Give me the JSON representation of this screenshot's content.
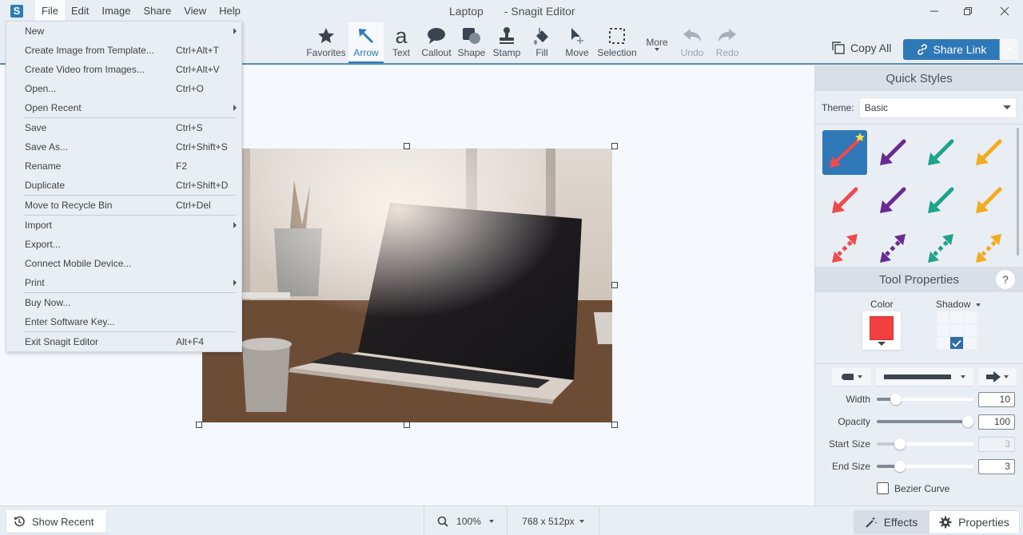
{
  "app": {
    "logo": "S",
    "document_title": "Laptop",
    "app_title": "- Snagit Editor"
  },
  "menubar": [
    {
      "label": "File",
      "active": true
    },
    {
      "label": "Edit"
    },
    {
      "label": "Image"
    },
    {
      "label": "Share"
    },
    {
      "label": "View"
    },
    {
      "label": "Help"
    }
  ],
  "window_controls": {
    "minimize": "minimize-icon",
    "restore": "restore-icon",
    "close": "close-icon"
  },
  "toolbar": {
    "tools": [
      {
        "label": "Favorites",
        "icon": "star-icon"
      },
      {
        "label": "Arrow",
        "icon": "arrow-icon",
        "selected": true
      },
      {
        "label": "Text",
        "icon": "text-icon"
      },
      {
        "label": "Callout",
        "icon": "callout-icon"
      },
      {
        "label": "Shape",
        "icon": "shape-icon"
      },
      {
        "label": "Stamp",
        "icon": "stamp-icon"
      },
      {
        "label": "Fill",
        "icon": "fill-icon"
      },
      {
        "label": "Move",
        "icon": "move-icon"
      },
      {
        "label": "Selection",
        "icon": "selection-icon"
      }
    ],
    "more_label": "More",
    "undo_label": "Undo",
    "redo_label": "Redo",
    "copy_all_label": "Copy All",
    "share_link_label": "Share Link"
  },
  "file_menu": {
    "groups": [
      [
        {
          "label": "New",
          "shortcut": "",
          "submenu": true
        },
        {
          "label": "Create Image from Template...",
          "shortcut": "Ctrl+Alt+T"
        },
        {
          "label": "Create Video from Images...",
          "shortcut": "Ctrl+Alt+V"
        },
        {
          "label": "Open...",
          "shortcut": "Ctrl+O"
        },
        {
          "label": "Open Recent",
          "shortcut": "",
          "submenu": true
        }
      ],
      [
        {
          "label": "Save",
          "shortcut": "Ctrl+S"
        },
        {
          "label": "Save As...",
          "shortcut": "Ctrl+Shift+S"
        },
        {
          "label": "Rename",
          "shortcut": "F2"
        },
        {
          "label": "Duplicate",
          "shortcut": "Ctrl+Shift+D"
        }
      ],
      [
        {
          "label": "Move to Recycle Bin",
          "shortcut": "Ctrl+Del"
        }
      ],
      [
        {
          "label": "Import",
          "shortcut": "",
          "submenu": true
        },
        {
          "label": "Export...",
          "shortcut": ""
        },
        {
          "label": "Connect Mobile Device...",
          "shortcut": ""
        },
        {
          "label": "Print",
          "shortcut": "",
          "submenu": true
        }
      ],
      [
        {
          "label": "Buy Now...",
          "shortcut": ""
        },
        {
          "label": "Enter Software Key...",
          "shortcut": ""
        }
      ],
      [
        {
          "label": "Exit Snagit Editor",
          "shortcut": "Alt+F4"
        }
      ]
    ]
  },
  "quick_styles": {
    "title": "Quick Styles",
    "theme_label": "Theme:",
    "theme_value": "Basic",
    "colors": [
      "#ef4b4b",
      "#6a2a96",
      "#1fa38a",
      "#f2ac1e"
    ],
    "selected_bg": "#2f78b7"
  },
  "tool_properties": {
    "title": "Tool Properties",
    "help": "?",
    "color_label": "Color",
    "color_value": "#f23f3f",
    "shadow_label": "Shadow",
    "shadow_selected": "bottom-center",
    "sliders": [
      {
        "label": "Width",
        "value": "10",
        "fraction": 0.2,
        "disabled": false
      },
      {
        "label": "Opacity",
        "value": "100",
        "fraction": 0.94,
        "disabled": false
      },
      {
        "label": "Start Size",
        "value": "3",
        "fraction": 0.24,
        "disabled": true
      },
      {
        "label": "End Size",
        "value": "3",
        "fraction": 0.24,
        "disabled": false
      }
    ],
    "bezier_label": "Bezier Curve",
    "bezier_checked": false
  },
  "statusbar": {
    "show_recent_label": "Show Recent",
    "zoom_value": "100%",
    "image_size": "768 x 512px",
    "effects_label": "Effects",
    "properties_label": "Properties"
  }
}
